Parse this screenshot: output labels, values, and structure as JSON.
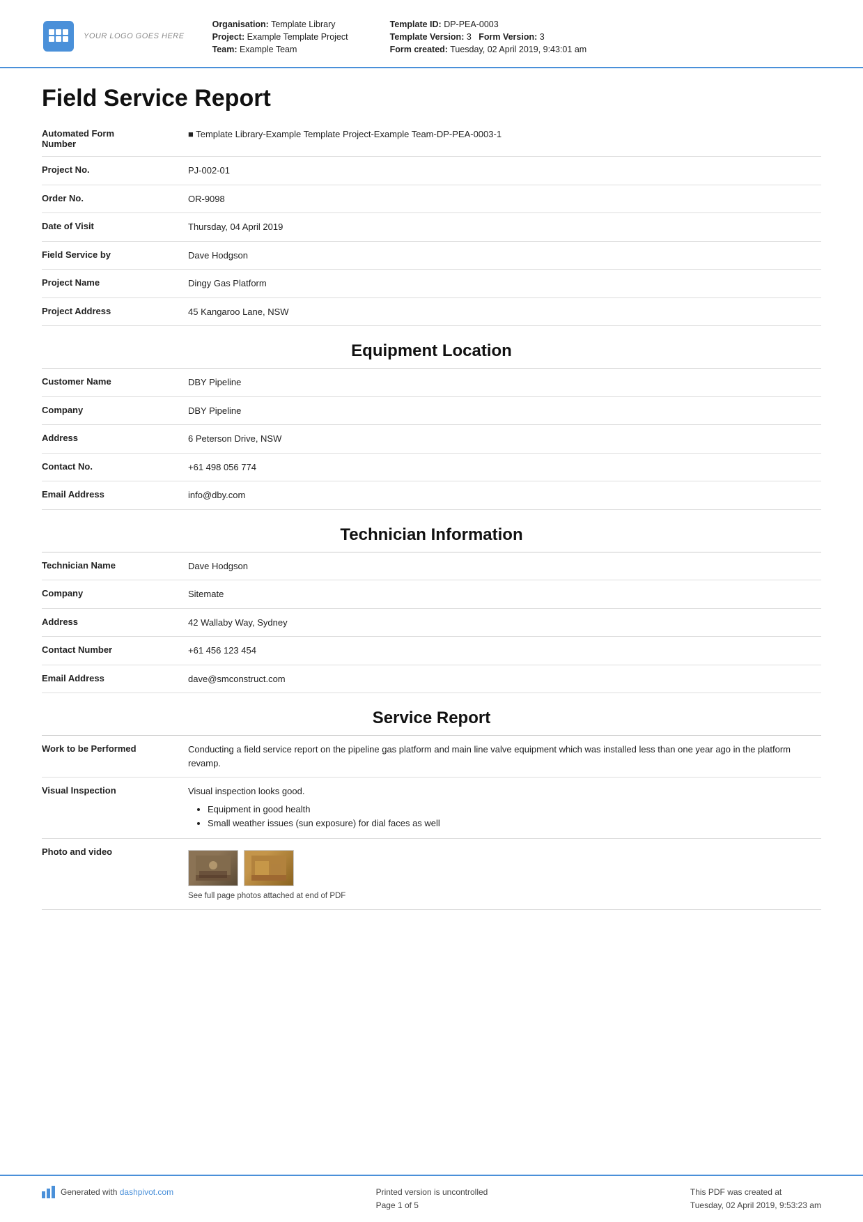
{
  "header": {
    "logo_text": "YOUR LOGO GOES HERE",
    "org_label": "Organisation:",
    "org_value": "Template Library",
    "project_label": "Project:",
    "project_value": "Example Template Project",
    "team_label": "Team:",
    "team_value": "Example Team",
    "template_id_label": "Template ID:",
    "template_id_value": "DP-PEA-0003",
    "template_version_label": "Template Version:",
    "template_version_value": "3",
    "form_version_label": "Form Version:",
    "form_version_value": "3",
    "form_created_label": "Form created:",
    "form_created_value": "Tuesday, 02 April 2019, 9:43:01 am"
  },
  "main_title": "Field Service Report",
  "fields": [
    {
      "label": "Automated Form Number",
      "value": "Template Library-Example Template Project-Example Team-DP-PEA-0003-1"
    },
    {
      "label": "Project No.",
      "value": "PJ-002-01"
    },
    {
      "label": "Order No.",
      "value": "OR-9098"
    },
    {
      "label": "Date of Visit",
      "value": "Thursday, 04 April 2019"
    },
    {
      "label": "Field Service by",
      "value": "Dave Hodgson"
    },
    {
      "label": "Project Name",
      "value": "Dingy Gas Platform"
    },
    {
      "label": "Project Address",
      "value": "45 Kangaroo Lane, NSW"
    }
  ],
  "section_equipment": "Equipment Location",
  "equipment_fields": [
    {
      "label": "Customer Name",
      "value": "DBY Pipeline"
    },
    {
      "label": "Company",
      "value": "DBY Pipeline"
    },
    {
      "label": "Address",
      "value": "6 Peterson Drive, NSW"
    },
    {
      "label": "Contact No.",
      "value": "+61 498 056 774"
    },
    {
      "label": "Email Address",
      "value": "info@dby.com"
    }
  ],
  "section_technician": "Technician Information",
  "technician_fields": [
    {
      "label": "Technician Name",
      "value": "Dave Hodgson"
    },
    {
      "label": "Company",
      "value": "Sitemate"
    },
    {
      "label": "Address",
      "value": "42 Wallaby Way, Sydney"
    },
    {
      "label": "Contact Number",
      "value": "+61 456 123 454"
    },
    {
      "label": "Email Address",
      "value": "dave@smconstruct.com"
    }
  ],
  "section_service": "Service Report",
  "service_fields": [
    {
      "label": "Work to be Performed",
      "value": "Conducting a field service report on the pipeline gas platform and main line valve equipment which was installed less than one year ago in the platform revamp."
    },
    {
      "label": "Visual Inspection",
      "value": "Visual inspection looks good.",
      "bullets": [
        "Equipment in good health",
        "Small weather issues (sun exposure) for dial faces as well"
      ]
    },
    {
      "label": "Photo and video",
      "photo_caption": "See full page photos attached at end of PDF"
    }
  ],
  "footer": {
    "generated_text": "Generated with ",
    "dashpivot_link": "dashpivot.com",
    "uncontrolled_text": "Printed version is uncontrolled",
    "page_text": "Page 1 of 5",
    "pdf_created_text": "This PDF was created at",
    "pdf_created_date": "Tuesday, 02 April 2019, 9:53:23 am"
  }
}
